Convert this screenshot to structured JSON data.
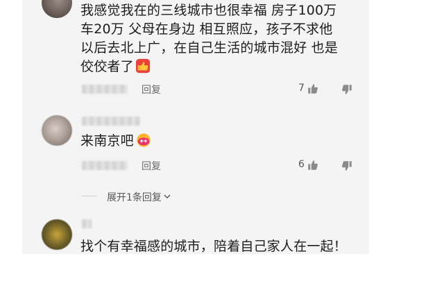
{
  "comments": [
    {
      "lines": [
        "我感觉我在的三线城市也很幸福 房子100万",
        "车20万 父母在身边 相互照应，孩子不求他",
        "以后去北上广，在自己生活的城市混好 也是",
        "佼佼者了"
      ],
      "reply_label": "回复",
      "like_count": "7"
    },
    {
      "lines": [
        "来南京吧"
      ],
      "reply_label": "回复",
      "like_count": "6",
      "expand_label": "展开1条回复"
    },
    {
      "lines": [
        "找个有幸福感的城市，陪着自己家人在一起！"
      ]
    }
  ],
  "icons": [
    "thumbs-up-emoji",
    "hug-emoji",
    "like-icon",
    "dislike-icon",
    "chevron-down-icon"
  ],
  "colors": {
    "panel": "#f4f4f4",
    "text": "#1c1c1c",
    "muted": "#6b6b6b"
  }
}
